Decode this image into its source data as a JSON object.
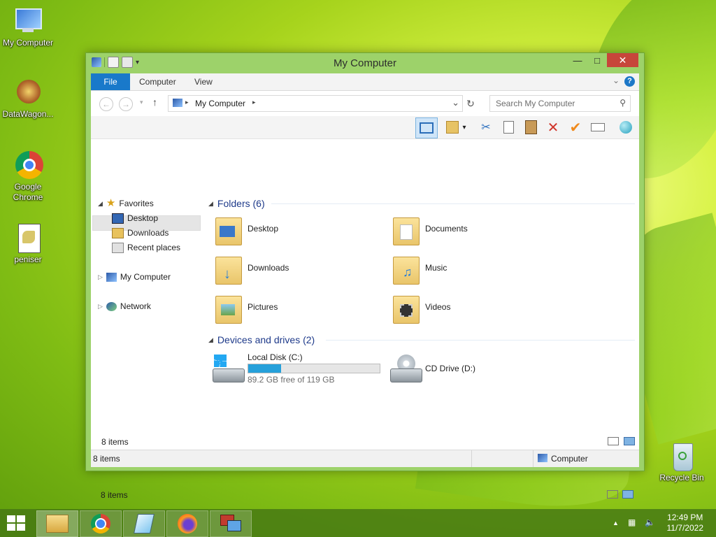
{
  "desktop": {
    "icons": [
      {
        "label": "My Computer"
      },
      {
        "label": "DataWagon..."
      },
      {
        "label": "Google Chrome"
      },
      {
        "label": "peniser"
      },
      {
        "label": "Recycle Bin"
      }
    ]
  },
  "window": {
    "title": "My Computer",
    "ribbon_tabs": {
      "file": "File",
      "computer": "Computer",
      "view": "View"
    },
    "help": "?",
    "address": "My Computer",
    "search_placeholder": "Search My Computer",
    "nav": {
      "favorites": "Favorites",
      "desktop": "Desktop",
      "downloads": "Downloads",
      "recent": "Recent places",
      "my_computer": "My Computer",
      "network": "Network"
    },
    "groups": {
      "folders": "Folders (6)",
      "devices": "Devices and drives (2)"
    },
    "folders": [
      {
        "name": "Desktop"
      },
      {
        "name": "Documents"
      },
      {
        "name": "Downloads"
      },
      {
        "name": "Music"
      },
      {
        "name": "Pictures"
      },
      {
        "name": "Videos"
      }
    ],
    "drives": {
      "c_name": "Local Disk (C:)",
      "c_free": "89.2 GB free of 119 GB",
      "c_used_fraction": 0.25,
      "d_name": "CD Drive (D:)"
    },
    "status_items_inner": "8 items",
    "status_items": "8 items",
    "status_location": "Computer"
  },
  "taskbar": {
    "time": "12:49 PM",
    "date": "11/7/2022"
  }
}
